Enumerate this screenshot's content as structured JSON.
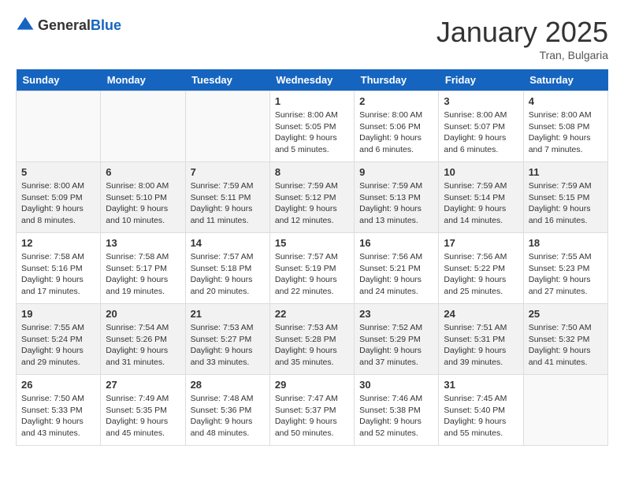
{
  "header": {
    "logo_general": "General",
    "logo_blue": "Blue",
    "title": "January 2025",
    "subtitle": "Tran, Bulgaria"
  },
  "days_of_week": [
    "Sunday",
    "Monday",
    "Tuesday",
    "Wednesday",
    "Thursday",
    "Friday",
    "Saturday"
  ],
  "weeks": [
    [
      {
        "day": "",
        "content": ""
      },
      {
        "day": "",
        "content": ""
      },
      {
        "day": "",
        "content": ""
      },
      {
        "day": "1",
        "content": "Sunrise: 8:00 AM\nSunset: 5:05 PM\nDaylight: 9 hours\nand 5 minutes."
      },
      {
        "day": "2",
        "content": "Sunrise: 8:00 AM\nSunset: 5:06 PM\nDaylight: 9 hours\nand 6 minutes."
      },
      {
        "day": "3",
        "content": "Sunrise: 8:00 AM\nSunset: 5:07 PM\nDaylight: 9 hours\nand 6 minutes."
      },
      {
        "day": "4",
        "content": "Sunrise: 8:00 AM\nSunset: 5:08 PM\nDaylight: 9 hours\nand 7 minutes."
      }
    ],
    [
      {
        "day": "5",
        "content": "Sunrise: 8:00 AM\nSunset: 5:09 PM\nDaylight: 9 hours\nand 8 minutes."
      },
      {
        "day": "6",
        "content": "Sunrise: 8:00 AM\nSunset: 5:10 PM\nDaylight: 9 hours\nand 10 minutes."
      },
      {
        "day": "7",
        "content": "Sunrise: 7:59 AM\nSunset: 5:11 PM\nDaylight: 9 hours\nand 11 minutes."
      },
      {
        "day": "8",
        "content": "Sunrise: 7:59 AM\nSunset: 5:12 PM\nDaylight: 9 hours\nand 12 minutes."
      },
      {
        "day": "9",
        "content": "Sunrise: 7:59 AM\nSunset: 5:13 PM\nDaylight: 9 hours\nand 13 minutes."
      },
      {
        "day": "10",
        "content": "Sunrise: 7:59 AM\nSunset: 5:14 PM\nDaylight: 9 hours\nand 14 minutes."
      },
      {
        "day": "11",
        "content": "Sunrise: 7:59 AM\nSunset: 5:15 PM\nDaylight: 9 hours\nand 16 minutes."
      }
    ],
    [
      {
        "day": "12",
        "content": "Sunrise: 7:58 AM\nSunset: 5:16 PM\nDaylight: 9 hours\nand 17 minutes."
      },
      {
        "day": "13",
        "content": "Sunrise: 7:58 AM\nSunset: 5:17 PM\nDaylight: 9 hours\nand 19 minutes."
      },
      {
        "day": "14",
        "content": "Sunrise: 7:57 AM\nSunset: 5:18 PM\nDaylight: 9 hours\nand 20 minutes."
      },
      {
        "day": "15",
        "content": "Sunrise: 7:57 AM\nSunset: 5:19 PM\nDaylight: 9 hours\nand 22 minutes."
      },
      {
        "day": "16",
        "content": "Sunrise: 7:56 AM\nSunset: 5:21 PM\nDaylight: 9 hours\nand 24 minutes."
      },
      {
        "day": "17",
        "content": "Sunrise: 7:56 AM\nSunset: 5:22 PM\nDaylight: 9 hours\nand 25 minutes."
      },
      {
        "day": "18",
        "content": "Sunrise: 7:55 AM\nSunset: 5:23 PM\nDaylight: 9 hours\nand 27 minutes."
      }
    ],
    [
      {
        "day": "19",
        "content": "Sunrise: 7:55 AM\nSunset: 5:24 PM\nDaylight: 9 hours\nand 29 minutes."
      },
      {
        "day": "20",
        "content": "Sunrise: 7:54 AM\nSunset: 5:26 PM\nDaylight: 9 hours\nand 31 minutes."
      },
      {
        "day": "21",
        "content": "Sunrise: 7:53 AM\nSunset: 5:27 PM\nDaylight: 9 hours\nand 33 minutes."
      },
      {
        "day": "22",
        "content": "Sunrise: 7:53 AM\nSunset: 5:28 PM\nDaylight: 9 hours\nand 35 minutes."
      },
      {
        "day": "23",
        "content": "Sunrise: 7:52 AM\nSunset: 5:29 PM\nDaylight: 9 hours\nand 37 minutes."
      },
      {
        "day": "24",
        "content": "Sunrise: 7:51 AM\nSunset: 5:31 PM\nDaylight: 9 hours\nand 39 minutes."
      },
      {
        "day": "25",
        "content": "Sunrise: 7:50 AM\nSunset: 5:32 PM\nDaylight: 9 hours\nand 41 minutes."
      }
    ],
    [
      {
        "day": "26",
        "content": "Sunrise: 7:50 AM\nSunset: 5:33 PM\nDaylight: 9 hours\nand 43 minutes."
      },
      {
        "day": "27",
        "content": "Sunrise: 7:49 AM\nSunset: 5:35 PM\nDaylight: 9 hours\nand 45 minutes."
      },
      {
        "day": "28",
        "content": "Sunrise: 7:48 AM\nSunset: 5:36 PM\nDaylight: 9 hours\nand 48 minutes."
      },
      {
        "day": "29",
        "content": "Sunrise: 7:47 AM\nSunset: 5:37 PM\nDaylight: 9 hours\nand 50 minutes."
      },
      {
        "day": "30",
        "content": "Sunrise: 7:46 AM\nSunset: 5:38 PM\nDaylight: 9 hours\nand 52 minutes."
      },
      {
        "day": "31",
        "content": "Sunrise: 7:45 AM\nSunset: 5:40 PM\nDaylight: 9 hours\nand 55 minutes."
      },
      {
        "day": "",
        "content": ""
      }
    ]
  ]
}
